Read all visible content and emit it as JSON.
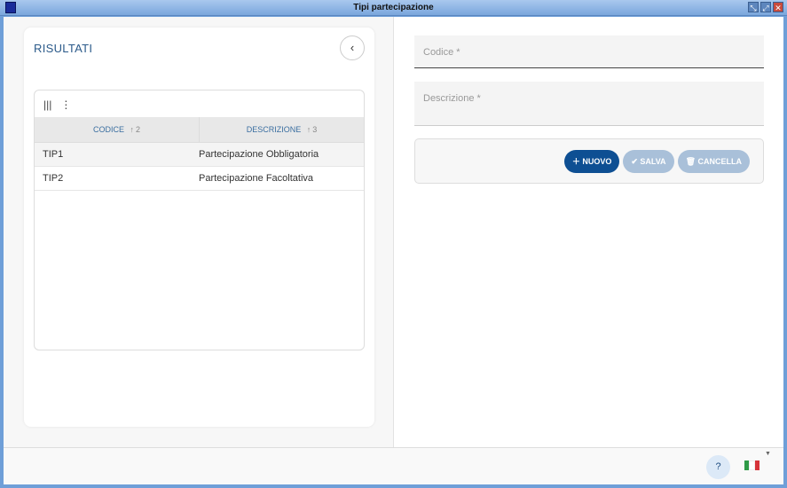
{
  "window": {
    "title": "Tipi partecipazione",
    "buttons": [
      "⤡",
      "⤢",
      "✕"
    ]
  },
  "left": {
    "title": "RISULTATI",
    "back": "‹",
    "grid": {
      "columns": [
        {
          "label": "CODICE",
          "sort": "↑",
          "order": "2"
        },
        {
          "label": "DESCRIZIONE",
          "sort": "↑",
          "order": "3"
        }
      ],
      "rows": [
        [
          "TIP1",
          "Partecipazione Obbligatoria"
        ],
        [
          "TIP2",
          "Partecipazione Facoltativa"
        ]
      ]
    }
  },
  "form": {
    "codice_placeholder": "Codice *",
    "descrizione_placeholder": "Descrizione *",
    "buttons": {
      "nuovo": "NUOVO",
      "salva": "SALVA",
      "cancella": "CANCELLA"
    }
  },
  "footer": {
    "help": "?",
    "flag_colors": [
      "#2e9a47",
      "#ffffff",
      "#d6343a"
    ]
  }
}
